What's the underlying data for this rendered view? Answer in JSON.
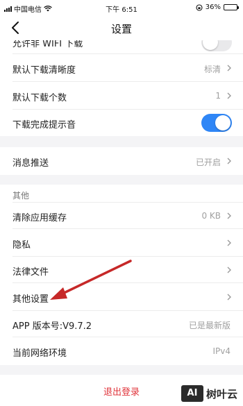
{
  "status_bar": {
    "carrier": "中国电信",
    "time": "下午 6:51",
    "battery_text": "36%",
    "battery_level": 0.36
  },
  "nav": {
    "title": "设置",
    "back_icon": "chevron-left-icon"
  },
  "settings": {
    "partial_row_label": "允许非 WIFI 下载",
    "download_quality_label": "默认下载清晰度",
    "download_quality_value": "标清",
    "download_count_label": "默认下载个数",
    "download_count_value": "1",
    "download_sound_label": "下载完成提示音",
    "push_label": "消息推送",
    "push_value": "已开启"
  },
  "other_section": {
    "header": "其他",
    "clear_cache_label": "清除应用缓存",
    "clear_cache_value": "0 KB",
    "privacy_label": "隐私",
    "legal_label": "法律文件",
    "other_settings_label": "其他设置",
    "version_label": "APP 版本号:V9.7.2",
    "version_value": "已是最新版",
    "network_label": "当前网络环境",
    "network_value": "IPv4"
  },
  "logout": {
    "label": "退出登录"
  },
  "watermark": {
    "logo": "AI",
    "text": "树叶云"
  },
  "colors": {
    "accent": "#2f86f6",
    "danger": "#e0343b",
    "annotation_arrow": "#c62828"
  }
}
